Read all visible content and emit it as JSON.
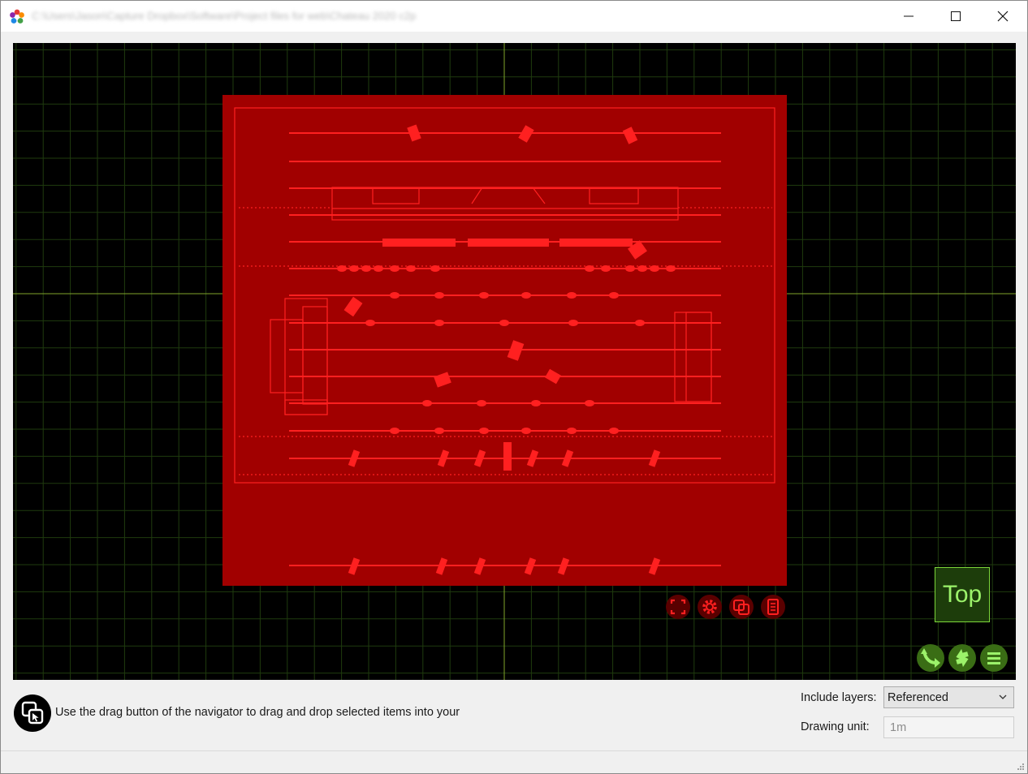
{
  "window": {
    "title": "C:\\Users\\Jason\\Capture Dropbox\\Software\\Project files for web\\Chateau 2020 c2p",
    "controls": [
      "minimize-icon",
      "maximize-icon",
      "close-icon"
    ]
  },
  "viewport": {
    "background": "#000000",
    "grid_color": "#1f3b0e",
    "axis_color": "#7fa52a",
    "selection_color": "#a10000",
    "drawing_color": "#ff1a1a",
    "view_label": "Top",
    "canvas_tools": [
      "fit-view-icon",
      "settings-gear-icon",
      "drag-drop-icon",
      "list-icon"
    ],
    "nav_buttons": [
      "rotate-arrow-icon",
      "flip-arrows-icon",
      "menu-icon"
    ]
  },
  "footer": {
    "hint": "Use the drag button of the navigator to drag and drop selected items into your",
    "include_layers_label": "Include layers:",
    "include_layers_value": "Referenced",
    "drawing_unit_label": "Drawing unit:",
    "drawing_unit_value": "1m"
  }
}
